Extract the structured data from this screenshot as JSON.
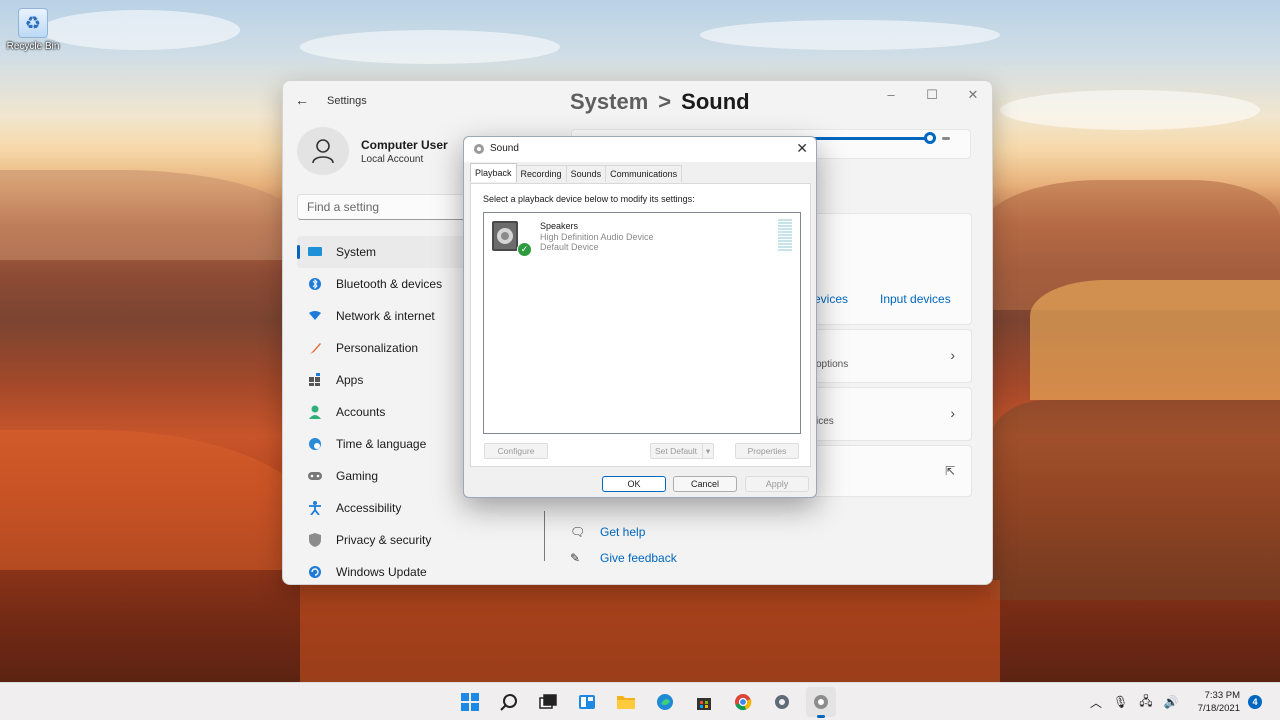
{
  "desktop": {
    "recycle_bin_label": "Recycle Bin"
  },
  "settings": {
    "app_title": "Settings",
    "user": {
      "name": "Computer User",
      "account_type": "Local Account"
    },
    "search_placeholder": "Find a setting",
    "breadcrumb": {
      "parent": "System",
      "separator": ">",
      "current": "Sound"
    },
    "nav": [
      {
        "label": "System",
        "icon": "monitor-icon",
        "selected": true
      },
      {
        "label": "Bluetooth & devices",
        "icon": "bluetooth-icon"
      },
      {
        "label": "Network & internet",
        "icon": "wifi-icon"
      },
      {
        "label": "Personalization",
        "icon": "brush-icon"
      },
      {
        "label": "Apps",
        "icon": "apps-icon"
      },
      {
        "label": "Accounts",
        "icon": "person-icon"
      },
      {
        "label": "Time & language",
        "icon": "globe-clock-icon"
      },
      {
        "label": "Gaming",
        "icon": "gamepad-icon"
      },
      {
        "label": "Accessibility",
        "icon": "accessibility-icon"
      },
      {
        "label": "Privacy & security",
        "icon": "shield-icon"
      },
      {
        "label": "Windows Update",
        "icon": "update-icon"
      }
    ],
    "links": {
      "output_devices_partial": "evices",
      "input_devices": "Input devices"
    },
    "cards": {
      "options_partial": "options",
      "devices_partial": "ices"
    },
    "help": {
      "get_help": "Get help",
      "give_feedback": "Give feedback"
    },
    "volume_level": 0.96
  },
  "dialog": {
    "title": "Sound",
    "tabs": [
      "Playback",
      "Recording",
      "Sounds",
      "Communications"
    ],
    "instruction": "Select a playback device below to modify its settings:",
    "device": {
      "name": "Speakers",
      "driver": "High Definition Audio Device",
      "status": "Default Device"
    },
    "buttons": {
      "configure": "Configure",
      "set_default": "Set Default",
      "set_default_arrow": "▾",
      "properties": "Properties",
      "ok": "OK",
      "cancel": "Cancel",
      "apply": "Apply"
    }
  },
  "taskbar": {
    "apps": [
      "start-icon",
      "search-icon",
      "task-view-icon",
      "widgets-icon",
      "file-explorer-icon",
      "edge-icon",
      "store-icon",
      "chrome-icon",
      "settings-icon",
      "sound-icon"
    ],
    "time": "7:33 PM",
    "date": "7/18/2021",
    "notification_count": "4"
  },
  "colors": {
    "accent": "#0067c0",
    "default_check": "#2f9b3f"
  }
}
